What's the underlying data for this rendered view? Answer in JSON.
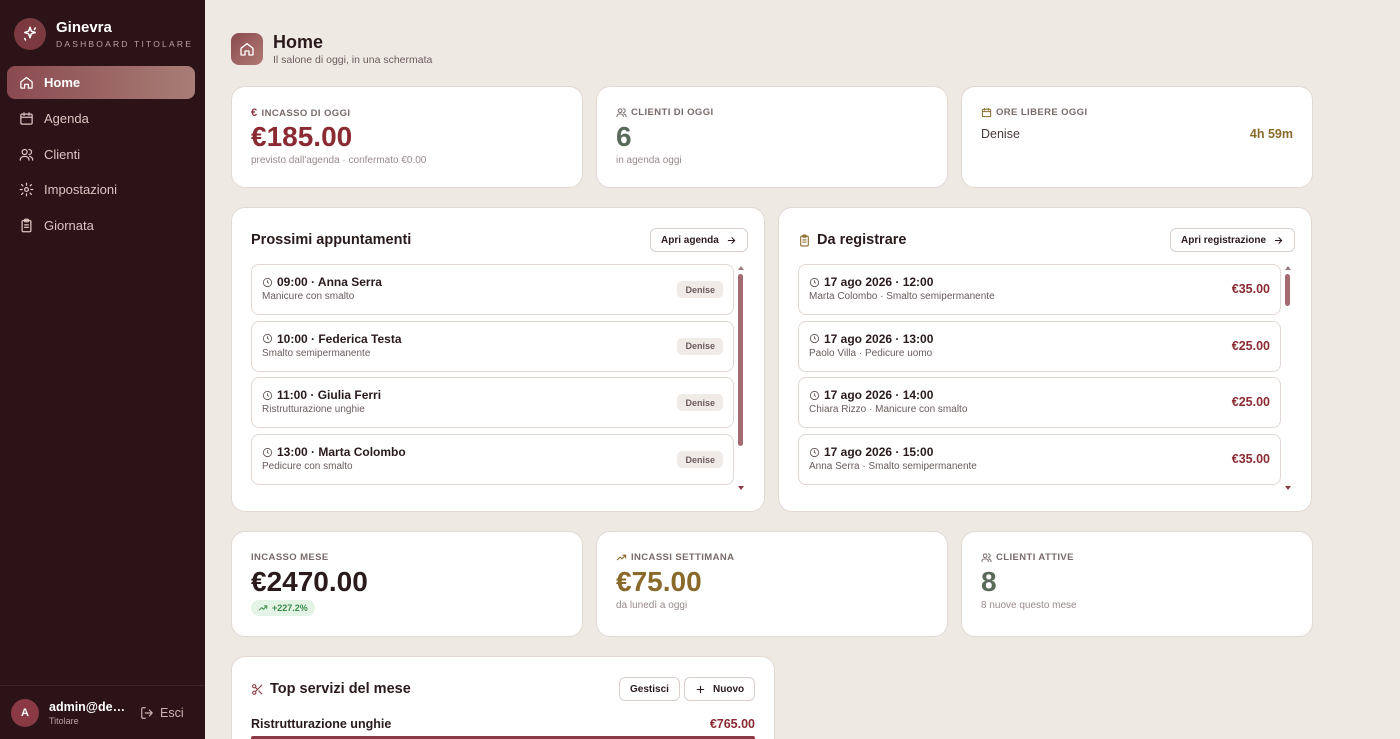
{
  "colors": {
    "sidebar": "#2b1317",
    "accent": "#8a3a44",
    "background": "#efe9e4",
    "green": "#3a8a4a",
    "gold": "#8a6a2a",
    "olive": "#5a6a5a"
  },
  "sidebar": {
    "brand": {
      "name": "Ginevra",
      "subtitle": "DASHBOARD TITOLARE",
      "icon": "sparkle-icon"
    },
    "items": [
      {
        "label": "Home",
        "icon": "home-icon",
        "active": true
      },
      {
        "label": "Agenda",
        "icon": "calendar-icon",
        "active": false
      },
      {
        "label": "Clienti",
        "icon": "users-icon",
        "active": false
      },
      {
        "label": "Impostazioni",
        "icon": "gear-icon",
        "active": false
      },
      {
        "label": "Giornata",
        "icon": "clipboard-icon",
        "active": false
      }
    ],
    "user": {
      "initial": "A",
      "email": "admin@demo.it",
      "role": "Titolare",
      "logout_label": "Esci"
    }
  },
  "header": {
    "title": "Home",
    "subtitle": "Il salone di oggi, in una schermata"
  },
  "stats_top": [
    {
      "label": "INCASSO DI OGGI",
      "icon": "euro-icon",
      "value": "€185.00",
      "note": "previsto dall'agenda · confermato €0.00"
    },
    {
      "label": "CLIENTI DI OGGI",
      "icon": "users-icon",
      "value": "6",
      "note": "in agenda oggi"
    },
    {
      "label": "ORE LIBERE OGGI",
      "icon": "calendar-icon",
      "staff_name": "Denise",
      "staff_value": "4h 59m"
    }
  ],
  "appointments": {
    "title": "Prossimi appuntamenti",
    "button": "Apri agenda",
    "items": [
      {
        "title": "09:00 · Anna Serra",
        "service": "Manicure con smalto",
        "staff": "Denise"
      },
      {
        "title": "10:00 · Federica Testa",
        "service": "Smalto semipermanente",
        "staff": "Denise"
      },
      {
        "title": "11:00 · Giulia Ferri",
        "service": "Ristrutturazione unghie",
        "staff": "Denise"
      },
      {
        "title": "13:00 · Marta Colombo",
        "service": "Pedicure con smalto",
        "staff": "Denise"
      }
    ]
  },
  "to_register": {
    "title": "Da registrare",
    "button": "Apri registrazione",
    "items": [
      {
        "title": "17 ago 2026 · 12:00",
        "detail": "Marta Colombo · Smalto semipermanente",
        "amount": "€35.00"
      },
      {
        "title": "17 ago 2026 · 13:00",
        "detail": "Paolo Villa · Pedicure uomo",
        "amount": "€25.00"
      },
      {
        "title": "17 ago 2026 · 14:00",
        "detail": "Chiara Rizzo · Manicure con smalto",
        "amount": "€25.00"
      },
      {
        "title": "17 ago 2026 · 15:00",
        "detail": "Anna Serra · Smalto semipermanente",
        "amount": "€35.00"
      }
    ]
  },
  "stats_bottom": [
    {
      "label": "INCASSO MESE",
      "value": "€2470.00",
      "delta": "+227.2%"
    },
    {
      "label": "INCASSI SETTIMANA",
      "icon": "trend-up-icon",
      "value": "€75.00",
      "note": "da lunedì a oggi"
    },
    {
      "label": "CLIENTI ATTIVE",
      "icon": "users-icon",
      "value": "8",
      "note": "8 nuove questo mese"
    }
  ],
  "top_services": {
    "title": "Top servizi del mese",
    "manage_label": "Gestisci",
    "new_label": "Nuovo",
    "items": [
      {
        "name": "Ristrutturazione unghie",
        "amount": "€765.00",
        "share": 1.0
      }
    ]
  }
}
